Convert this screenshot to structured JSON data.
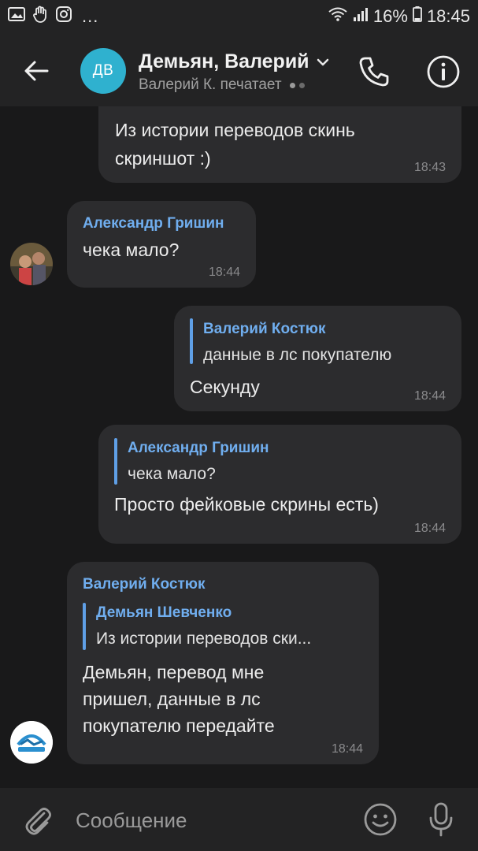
{
  "status_bar": {
    "left_icons": [
      "gallery-icon",
      "hand-icon",
      "instagram-icon"
    ],
    "dots": "...",
    "battery": "16%",
    "time": "18:45"
  },
  "header": {
    "avatar_initials": "ДВ",
    "title": "Демьян, Валерий",
    "subtitle": "Валерий К. печатает",
    "icons": [
      "back-arrow-icon",
      "chevron-down-icon",
      "phone-icon",
      "info-icon"
    ]
  },
  "messages": [
    {
      "side": "outgoing",
      "lines": [
        "Из истории переводов скинь",
        "скриншот :)"
      ],
      "time": "18:43"
    },
    {
      "side": "incoming",
      "sender": "Александр Гришин",
      "lines": [
        "чека мало?"
      ],
      "time": "18:44"
    },
    {
      "side": "outgoing",
      "quote": {
        "name": "Валерий Костюк",
        "text": "данные в лс покупателю"
      },
      "lines": [
        "Секунду"
      ],
      "time": "18:44"
    },
    {
      "side": "outgoing",
      "quote": {
        "name": "Александр Гришин",
        "text": "чека мало?"
      },
      "lines": [
        "Просто фейковые скрины есть)"
      ],
      "time": "18:44"
    },
    {
      "side": "incoming",
      "sender": "Валерий Костюк",
      "quote": {
        "name": "Демьян Шевченко",
        "text": "Из истории переводов ски..."
      },
      "lines": [
        "Демьян, перевод мне",
        "пришел, данные в лс",
        "покупателю передайте"
      ],
      "time": "18:44"
    }
  ],
  "composer": {
    "placeholder": "Сообщение",
    "icons": [
      "paperclip-icon",
      "emoji-icon",
      "microphone-icon"
    ]
  },
  "colors": {
    "background": "#19191a",
    "bar": "#232324",
    "bubble": "#2c2c2e",
    "accent": "#70aeef",
    "avatar": "#2fb1cf"
  }
}
